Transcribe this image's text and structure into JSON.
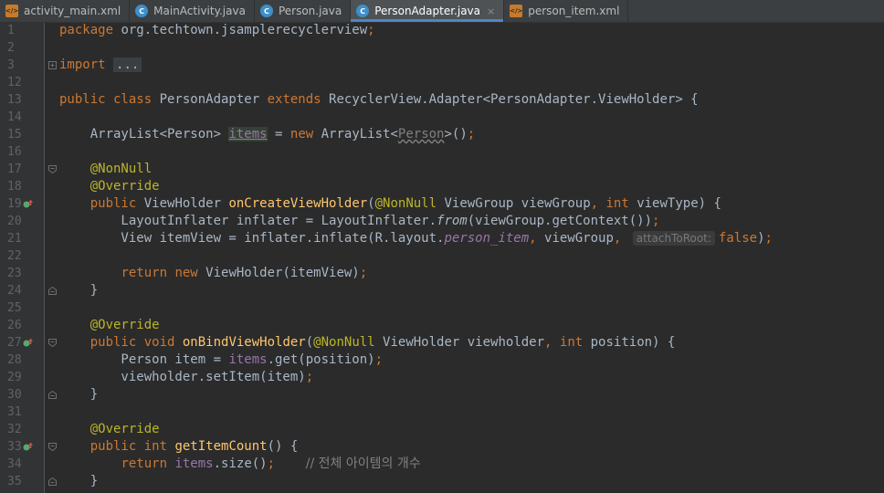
{
  "tabs": [
    {
      "label": "activity_main.xml",
      "icon": "xml-file-icon"
    },
    {
      "label": "MainActivity.java",
      "icon": "java-class-icon"
    },
    {
      "label": "Person.java",
      "icon": "java-class-icon"
    },
    {
      "label": "PersonAdapter.java",
      "icon": "java-class-icon"
    },
    {
      "label": "person_item.xml",
      "icon": "xml-file-icon"
    }
  ],
  "active_tab_index": 3,
  "tab_icon_text": {
    "xml": "</>",
    "java": "C"
  },
  "close_glyph": "×",
  "colors": {
    "keyword": "#cc7832",
    "annotation": "#bbb529",
    "method": "#ffc66d",
    "field": "#9876aa",
    "comment": "#808080",
    "text": "#a9b7c6",
    "override_marker": "#59a869"
  },
  "editor": {
    "lines": [
      {
        "n": "1",
        "parts": [
          {
            "t": "package",
            "c": "kw"
          },
          {
            "t": " org.techtown.jsamplerecyclerview"
          },
          {
            "t": ";",
            "c": "kw"
          }
        ]
      },
      {
        "n": "2",
        "parts": []
      },
      {
        "n": "3",
        "fold": "box",
        "parts": [
          {
            "t": "import",
            "c": "kw"
          },
          {
            "t": " "
          },
          {
            "t": "...",
            "c": "folded"
          }
        ]
      },
      {
        "n": "12",
        "parts": []
      },
      {
        "n": "13",
        "parts": [
          {
            "t": "public class ",
            "c": "kw"
          },
          {
            "t": "PersonAdapter "
          },
          {
            "t": "extends ",
            "c": "kw"
          },
          {
            "t": "RecyclerView.Adapter<PersonAdapter.ViewHolder> {"
          }
        ]
      },
      {
        "n": "14",
        "parts": []
      },
      {
        "n": "15",
        "parts": [
          {
            "t": "    ArrayList<Person> "
          },
          {
            "t": "items",
            "c": "hl"
          },
          {
            "t": " = "
          },
          {
            "t": "new ",
            "c": "kw"
          },
          {
            "t": "ArrayList<"
          },
          {
            "t": "Person",
            "c": "wav"
          },
          {
            "t": ">()"
          },
          {
            "t": ";",
            "c": "kw"
          }
        ]
      },
      {
        "n": "16",
        "parts": []
      },
      {
        "n": "17",
        "fold": "start",
        "parts": [
          {
            "t": "    "
          },
          {
            "t": "@NonNull",
            "c": "an"
          }
        ]
      },
      {
        "n": "18",
        "parts": [
          {
            "t": "    "
          },
          {
            "t": "@Override",
            "c": "an"
          }
        ]
      },
      {
        "n": "19",
        "override": true,
        "parts": [
          {
            "t": "    "
          },
          {
            "t": "public ",
            "c": "kw"
          },
          {
            "t": "ViewHolder "
          },
          {
            "t": "onCreateViewHolder",
            "c": "fn"
          },
          {
            "t": "("
          },
          {
            "t": "@NonNull",
            "c": "an"
          },
          {
            "t": " ViewGroup viewGroup"
          },
          {
            "t": ", int ",
            "c": "kw"
          },
          {
            "t": "viewType) {"
          }
        ]
      },
      {
        "n": "20",
        "parts": [
          {
            "t": "        LayoutInflater inflater = LayoutInflater."
          },
          {
            "t": "from",
            "c": "it"
          },
          {
            "t": "(viewGroup.getContext())"
          },
          {
            "t": ";",
            "c": "kw"
          }
        ]
      },
      {
        "n": "21",
        "parts": [
          {
            "t": "        View itemView = inflater.inflate(R.layout."
          },
          {
            "t": "person_item",
            "c": "fdi"
          },
          {
            "t": ", ",
            "c": "kw"
          },
          {
            "t": "viewGroup"
          },
          {
            "t": ", ",
            "c": "kw"
          },
          {
            "t": "attachToRoot:",
            "c": "hint"
          },
          {
            "t": "false",
            "c": "kw"
          },
          {
            "t": ")"
          },
          {
            "t": ";",
            "c": "kw"
          }
        ]
      },
      {
        "n": "22",
        "parts": []
      },
      {
        "n": "23",
        "parts": [
          {
            "t": "        "
          },
          {
            "t": "return new ",
            "c": "kw"
          },
          {
            "t": "ViewHolder(itemView)"
          },
          {
            "t": ";",
            "c": "kw"
          }
        ]
      },
      {
        "n": "24",
        "fold": "end",
        "parts": [
          {
            "t": "    }"
          }
        ]
      },
      {
        "n": "25",
        "parts": []
      },
      {
        "n": "26",
        "parts": [
          {
            "t": "    "
          },
          {
            "t": "@Override",
            "c": "an"
          }
        ]
      },
      {
        "n": "27",
        "override": true,
        "fold": "start",
        "parts": [
          {
            "t": "    "
          },
          {
            "t": "public void ",
            "c": "kw"
          },
          {
            "t": "onBindViewHolder",
            "c": "fn"
          },
          {
            "t": "("
          },
          {
            "t": "@NonNull",
            "c": "an"
          },
          {
            "t": " ViewHolder viewholder"
          },
          {
            "t": ", int ",
            "c": "kw"
          },
          {
            "t": "position) {"
          }
        ]
      },
      {
        "n": "28",
        "parts": [
          {
            "t": "        Person item = "
          },
          {
            "t": "items",
            "c": "fd"
          },
          {
            "t": ".get(position)"
          },
          {
            "t": ";",
            "c": "kw"
          }
        ]
      },
      {
        "n": "29",
        "parts": [
          {
            "t": "        viewholder.setItem(item)"
          },
          {
            "t": ";",
            "c": "kw"
          }
        ]
      },
      {
        "n": "30",
        "fold": "end",
        "parts": [
          {
            "t": "    }"
          }
        ]
      },
      {
        "n": "31",
        "parts": []
      },
      {
        "n": "32",
        "parts": [
          {
            "t": "    "
          },
          {
            "t": "@Override",
            "c": "an"
          }
        ]
      },
      {
        "n": "33",
        "override": true,
        "fold": "start",
        "parts": [
          {
            "t": "    "
          },
          {
            "t": "public int ",
            "c": "kw"
          },
          {
            "t": "getItemCount",
            "c": "fn"
          },
          {
            "t": "() {"
          }
        ]
      },
      {
        "n": "34",
        "parts": [
          {
            "t": "        "
          },
          {
            "t": "return ",
            "c": "kw"
          },
          {
            "t": "items",
            "c": "fd"
          },
          {
            "t": ".size()"
          },
          {
            "t": ";",
            "c": "kw"
          },
          {
            "t": "    "
          },
          {
            "t": "// 전체 아이템의 개수",
            "c": "cm korean"
          }
        ]
      },
      {
        "n": "35",
        "fold": "end",
        "parts": [
          {
            "t": "    }"
          }
        ]
      }
    ]
  }
}
